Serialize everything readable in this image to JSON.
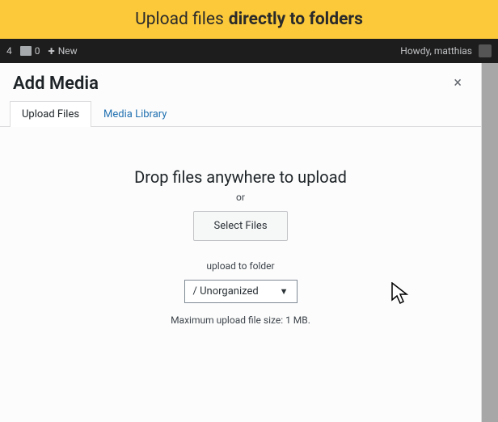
{
  "banner": {
    "text_light": "Upload files",
    "text_bold": "directly to folders"
  },
  "admin_bar": {
    "count_left": "4",
    "comments": "0",
    "new_label": "New",
    "howdy": "Howdy, matthias"
  },
  "modal": {
    "title": "Add Media",
    "close_label": "×"
  },
  "tabs": {
    "upload": "Upload Files",
    "library": "Media Library"
  },
  "upload": {
    "drop_text": "Drop files anywhere to upload",
    "or": "or",
    "select_button": "Select Files",
    "folder_label": "upload to folder",
    "folder_selected": "/ Unorganized",
    "max_size": "Maximum upload file size: 1 MB."
  }
}
